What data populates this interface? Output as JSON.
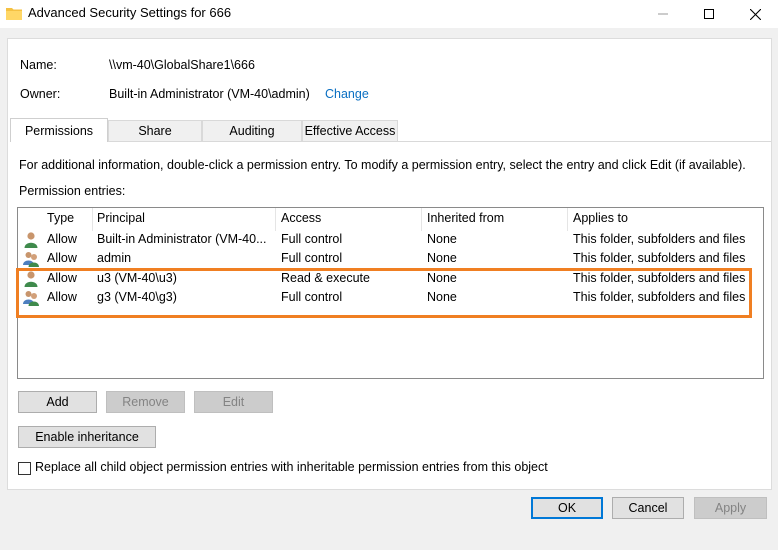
{
  "window": {
    "title": "Advanced Security Settings for 666",
    "icon": "folder-icon"
  },
  "info": {
    "name_label": "Name:",
    "name_value": "\\\\vm-40\\GlobalShare1\\666",
    "owner_label": "Owner:",
    "owner_value": "Built-in Administrator (VM-40\\admin)",
    "change_link": "Change"
  },
  "tabs": [
    {
      "label": "Permissions",
      "active": true
    },
    {
      "label": "Share",
      "active": false
    },
    {
      "label": "Auditing",
      "active": false
    },
    {
      "label": "Effective Access",
      "active": false
    }
  ],
  "permissions": {
    "info_text": "For additional information, double-click a permission entry. To modify a permission entry, select the entry and click Edit (if available).",
    "entries_label": "Permission entries:",
    "columns": [
      "Type",
      "Principal",
      "Access",
      "Inherited from",
      "Applies to"
    ],
    "rows": [
      {
        "icon": "user-icon",
        "type": "Allow",
        "principal": "Built-in Administrator (VM-40...",
        "access": "Full control",
        "inherited": "None",
        "applies": "This folder, subfolders and files"
      },
      {
        "icon": "group-icon",
        "type": "Allow",
        "principal": "admin",
        "access": "Full control",
        "inherited": "None",
        "applies": "This folder, subfolders and files"
      },
      {
        "icon": "user-icon",
        "type": "Allow",
        "principal": "u3 (VM-40\\u3)",
        "access": "Read & execute",
        "inherited": "None",
        "applies": "This folder, subfolders and files"
      },
      {
        "icon": "group-icon",
        "type": "Allow",
        "principal": "g3 (VM-40\\g3)",
        "access": "Full control",
        "inherited": "None",
        "applies": "This folder, subfolders and files"
      }
    ],
    "highlight_color": "#f07f22"
  },
  "buttons": {
    "add": "Add",
    "remove": "Remove",
    "edit": "Edit",
    "enable_inheritance": "Enable inheritance",
    "replace_checkbox_label": "Replace all child object permission entries with inheritable permission entries from this object",
    "ok": "OK",
    "cancel": "Cancel",
    "apply": "Apply"
  }
}
